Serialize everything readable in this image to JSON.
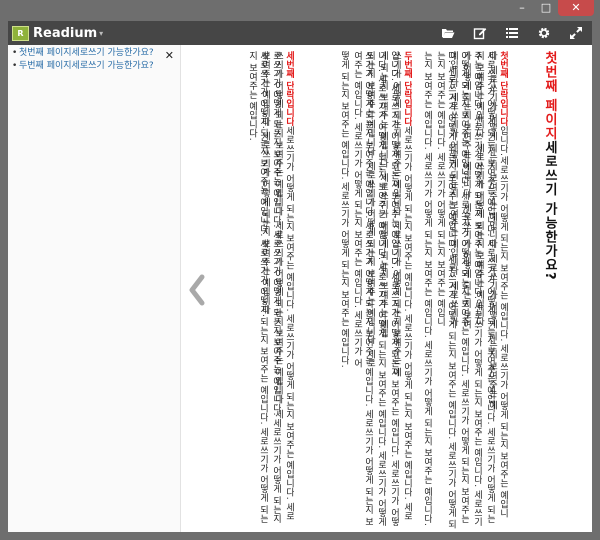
{
  "window": {
    "minimize": "–",
    "maximize": "□",
    "close": "✕"
  },
  "app": {
    "logo_mark": "R",
    "name": "Readium",
    "menu_caret": "▾"
  },
  "toolbar": {
    "icons": [
      "folder-open-icon",
      "edit-icon",
      "list-icon",
      "gear-icon",
      "expand-icon"
    ]
  },
  "toc": {
    "items": [
      "첫번째 페이지세로쓰기 가능한가요?",
      "두번째 페이지세로쓰기 가능한가요?"
    ],
    "close": "✕"
  },
  "reader": {
    "heading_red": "첫번째 페이지",
    "heading_rest": "세로쓰기 가능한가요?",
    "section1_red": "첫번째 단락입니다",
    "section2_red": "두번째 단락입니다",
    "section3_red": "세번째 단락입니다",
    "col1": "입니다.세로쓰기가 어떻게 되는지 보여주는 예입니다. 세로쓰기가 어떻게 되는지 보여주는 예입니다. 세로쓰기가 어떻게 되는지 보여주는 예입니다. 세로쓰기가 어떻게 되는지 보여주는 예",
    "col2": "세로쓰기가 어떻게 되는지 보여주는 예입니다. 세로쓰기가 어떻게 되는지 보여주는 예입니다. 세로쓰기가 어떻게 되는지 보여주는 예입니다. 세로쓰기가 어떻게 되는지 보여주는 예입니다.",
    "col3": "주는 예입니다. 세로쓰기가 어떻게 되는지 보여주는 예입니다. 세로쓰기가 어떻게 되는지 보여주는 예입니다. 세로쓰기가 어떻게 되는지 보여주는 예입니다. 세로쓰기가 어떻게 되는지 보여",
    "col4": "어떻게 되는지 보여주는 예입니다. 세로쓰기가 어떻게 되는지 보여주는 예입니다. 세로쓰기가 어떻게 되는지 보여주는 예입니다. 세로쓰기가 어떻게 되는지 보여주는 예입니다. 세로쓰기가",
    "col5": "다. 세로쓰기가 어떻게 되는지 보여주는 예입니다. 세로쓰기가 어떻게 되는지 보여주는 예입니다. 세로쓰기가 어떻게 되는지 보여주는 예입니다. 세로쓰기가 어떻게 되는지 보여주는 예입니",
    "col6": "는지 보여주는 예입니다. 세로쓰기가 어떻게 되는지 보여주는 예입니다. 세로쓰기가 어떻게 되는지 보여주는 예입니다.",
    "col7_rest": "세로쓰기가 어떻게 되는지 보여주는 예입니다. 세로쓰기가 어떻게 되는지 보여주는 예입니다. 세로쓰기가 어떻게 되는지 보여주는 예입니다. 세로쓰기가 어떻게 되는지 보여주는 예",
    "col8": "입니다. 세로쓰기가 어떻게 되는지 보여주는 예입니다. 세로쓰기가 어떻게 되는지 보여주는 예입니다. 세로쓰기가 어떻게 되는지 보여주는 예입니다. 세로쓰기가 어떻게 되는지 보여주는 예입",
    "col9": "니다. 세로쓰기가 어떻게 되는지 보여주는 예입니다. 세로쓰기가 어떻게 되는지 보여주는 예입니다. 세로쓰기가 어떻게 되는지 보여주는 예입니다. 세로쓰기가 어떻게 되는지 보여주는 예입니다. 세로",
    "col10": "쓰기가 어떻게 되는지 보여주는 예입니다. 세로쓰기가 어떻게 되는지 보여주는 예입니다. 세로쓰기가 어떻게 되는지 보여주는 예입니다. 세로쓰기가 어떻게 되는지 보여주는 예입니다. 세로쓰기가 어",
    "col11": "떻게 되는지 보여주는 예입니다. 세로쓰기가 어떻게 되는지 보여주는 예입니다.",
    "col12_rest": "세로쓰기가 어떻게 되는지 보여주는 예입니다. 세로쓰기가 어떻게 되는지 보여주는 예입니다. 세로쓰기가 어떻게 되는지 보여주는 예입니다. 세로쓰기가 어떻게 되는지 보여주는 예입니다. 세",
    "col13": "로쓰기가 어떻게 되는지 보여주는 예입니다. 세로쓰기가 어떻게 되는지 보여주는 예입니다. 세로쓰기가 어떻게 되는지 보여주는 예입니다. 세로쓰기가 어떻게 되는지 보여주는 예입니다.",
    "col14": "세로쓰기가 어떻게 되는지 보여주는 예입니다. 세로쓰기가 어떻게 되는지 보여주는 예입니다. 세로쓰기가 어떻게 되는지 보여주는 예입니다."
  },
  "colors": {
    "toolbar": "#464646",
    "accent_red": "#e31b1b",
    "link": "#2b6ea8",
    "close": "#c74b4b"
  }
}
